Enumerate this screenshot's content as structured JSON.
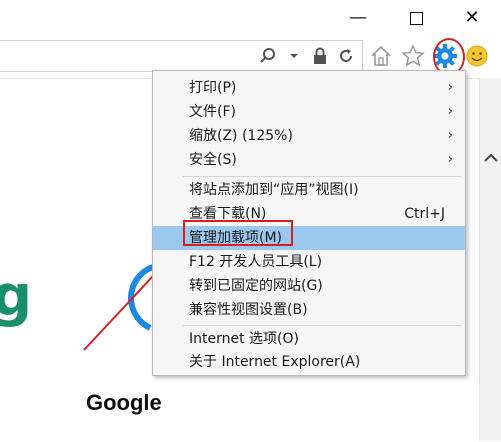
{
  "window": {
    "minimize_glyph": "—",
    "close_glyph": "✕"
  },
  "address_bar": {
    "icons": [
      "search-icon",
      "dropdown-arrow-icon",
      "lock-icon",
      "refresh-icon"
    ]
  },
  "toolbar": {
    "icons": [
      "home-icon",
      "favorites-star-icon",
      "tools-gear-icon",
      "smiley-feedback-icon"
    ],
    "accent_color": "#1e88e5"
  },
  "page": {
    "google_title": "Google",
    "g_fragment": "g"
  },
  "menu": {
    "items": [
      {
        "label": "打印(P)",
        "has_submenu": true
      },
      {
        "label": "文件(F)",
        "has_submenu": true
      },
      {
        "label": "缩放(Z) (125%)",
        "has_submenu": true
      },
      {
        "label": "安全(S)",
        "has_submenu": true
      },
      {
        "label": "将站点添加到“应用”视图(I)"
      },
      {
        "label": "查看下载(N)",
        "shortcut": "Ctrl+J"
      },
      {
        "label": "管理加载项(M)",
        "highlighted": true
      },
      {
        "label": "F12 开发人员工具(L)"
      },
      {
        "label": "转到已固定的网站(G)"
      },
      {
        "label": "兼容性视图设置(B)"
      },
      {
        "label": "Internet 选项(O)"
      },
      {
        "label": "关于 Internet Explorer(A)"
      }
    ],
    "submenu_arrow": "›",
    "highlight_color": "#9bc8ee",
    "annotation_color": "#d62020"
  }
}
